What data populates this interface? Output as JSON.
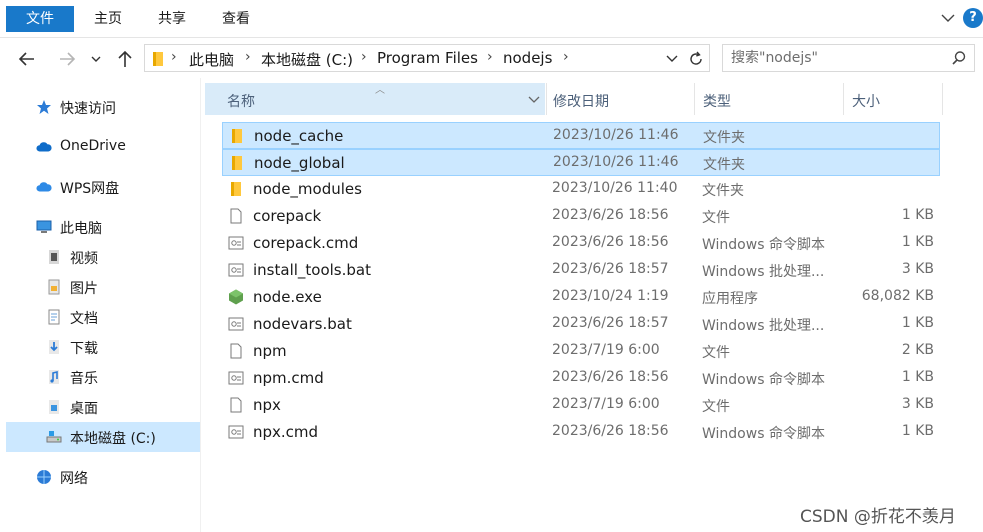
{
  "ribbon": {
    "tabs": [
      "文件",
      "主页",
      "共享",
      "查看"
    ],
    "help": "?"
  },
  "address": {
    "breadcrumbs": [
      "此电脑",
      "本地磁盘 (C:)",
      "Program Files",
      "nodejs"
    ]
  },
  "search": {
    "placeholder": "搜索\"nodejs\""
  },
  "sidebar": {
    "items": [
      {
        "label": "快速访问",
        "icon": "star-icon",
        "level": 0
      },
      {
        "label": "OneDrive",
        "icon": "cloud-icon",
        "level": 0
      },
      {
        "label": "WPS网盘",
        "icon": "cloud-icon",
        "level": 0
      },
      {
        "label": "此电脑",
        "icon": "computer-icon",
        "level": 0
      },
      {
        "label": "视频",
        "icon": "video-icon",
        "level": 1
      },
      {
        "label": "图片",
        "icon": "image-icon",
        "level": 1
      },
      {
        "label": "文档",
        "icon": "document-icon",
        "level": 1
      },
      {
        "label": "下载",
        "icon": "download-icon",
        "level": 1
      },
      {
        "label": "音乐",
        "icon": "music-icon",
        "level": 1
      },
      {
        "label": "桌面",
        "icon": "desktop-icon",
        "level": 1
      },
      {
        "label": "本地磁盘 (C:)",
        "icon": "drive-icon",
        "level": 1,
        "selected": true
      },
      {
        "label": "网络",
        "icon": "network-icon",
        "level": 0
      }
    ]
  },
  "columns": {
    "name": "名称",
    "date": "修改日期",
    "type": "类型",
    "size": "大小"
  },
  "files": [
    {
      "name": "node_cache",
      "date": "2023/10/26 11:46",
      "type": "文件夹",
      "size": "",
      "icon": "folder-icon",
      "selected": true
    },
    {
      "name": "node_global",
      "date": "2023/10/26 11:46",
      "type": "文件夹",
      "size": "",
      "icon": "folder-icon",
      "selected": true
    },
    {
      "name": "node_modules",
      "date": "2023/10/26 11:40",
      "type": "文件夹",
      "size": "",
      "icon": "folder-icon",
      "selected": false
    },
    {
      "name": "corepack",
      "date": "2023/6/26 18:56",
      "type": "文件",
      "size": "1 KB",
      "icon": "file-icon",
      "selected": false
    },
    {
      "name": "corepack.cmd",
      "date": "2023/6/26 18:56",
      "type": "Windows 命令脚本",
      "size": "1 KB",
      "icon": "script-icon",
      "selected": false
    },
    {
      "name": "install_tools.bat",
      "date": "2023/6/26 18:57",
      "type": "Windows 批处理...",
      "size": "3 KB",
      "icon": "script-icon",
      "selected": false
    },
    {
      "name": "node.exe",
      "date": "2023/10/24 1:19",
      "type": "应用程序",
      "size": "68,082 KB",
      "icon": "node-exe-icon",
      "selected": false
    },
    {
      "name": "nodevars.bat",
      "date": "2023/6/26 18:57",
      "type": "Windows 批处理...",
      "size": "1 KB",
      "icon": "script-icon",
      "selected": false
    },
    {
      "name": "npm",
      "date": "2023/7/19 6:00",
      "type": "文件",
      "size": "2 KB",
      "icon": "file-icon",
      "selected": false
    },
    {
      "name": "npm.cmd",
      "date": "2023/6/26 18:56",
      "type": "Windows 命令脚本",
      "size": "1 KB",
      "icon": "script-icon",
      "selected": false
    },
    {
      "name": "npx",
      "date": "2023/7/19 6:00",
      "type": "文件",
      "size": "3 KB",
      "icon": "file-icon",
      "selected": false
    },
    {
      "name": "npx.cmd",
      "date": "2023/6/26 18:56",
      "type": "Windows 命令脚本",
      "size": "1 KB",
      "icon": "script-icon",
      "selected": false
    }
  ],
  "watermark": "CSDN @折花不羡月",
  "colors": {
    "accent": "#1979ca",
    "selection": "#cce8ff",
    "folder": "#ffc83d"
  }
}
